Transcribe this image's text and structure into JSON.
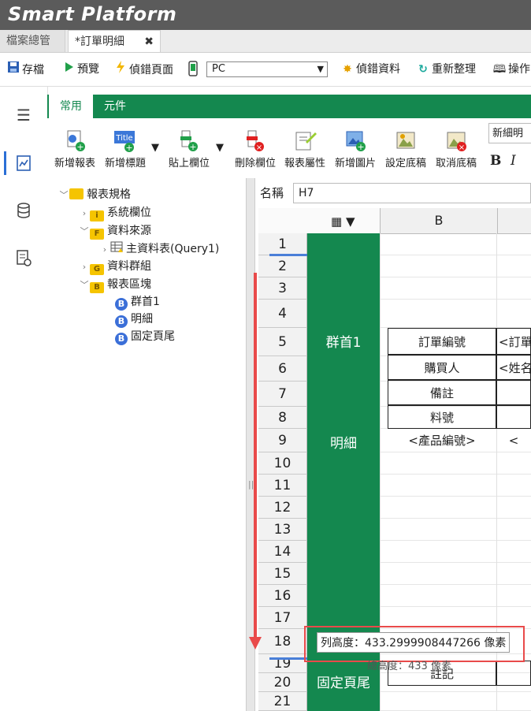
{
  "app": {
    "title": "Smart Platform"
  },
  "doc_tabs": [
    {
      "label": "檔案總管"
    },
    {
      "label": "*訂單明細",
      "close": "✖"
    }
  ],
  "toolbar": {
    "save": "存檔",
    "preview": "預覽",
    "debug_page": "偵錯頁面",
    "device_select": "PC",
    "debug_data": "偵錯資料",
    "refresh": "重新整理",
    "ops": "操作"
  },
  "ribbon": {
    "tabs": [
      "常用",
      "元件"
    ],
    "buttons": [
      "新增報表",
      "新增標題",
      "貼上欄位",
      "刪除欄位",
      "報表屬性",
      "新增圖片",
      "設定底稿",
      "取消底稿"
    ],
    "title_icon_text": "Title",
    "style_box": "新細明",
    "bold": "B",
    "italic": "I"
  },
  "tree": {
    "root": "報表規格",
    "items": [
      {
        "label": "系統欄位",
        "badge": "i"
      },
      {
        "label": "資料來源",
        "badge": "F"
      },
      {
        "label": "主資料表(Query1)"
      },
      {
        "label": "資料群組",
        "badge": "G"
      },
      {
        "label": "報表區塊",
        "badge": "B"
      },
      {
        "label": "群首1",
        "badge": "B"
      },
      {
        "label": "明細",
        "badge": "B"
      },
      {
        "label": "固定頁尾",
        "badge": "B"
      }
    ]
  },
  "namebar": {
    "label": "名稱",
    "value": "H7"
  },
  "grid": {
    "column_header": "B",
    "rows": [
      "1",
      "2",
      "3",
      "4",
      "5",
      "6",
      "7",
      "8",
      "9",
      "10",
      "11",
      "12",
      "13",
      "14",
      "15",
      "16",
      "17",
      "18",
      "19",
      "20",
      "21"
    ],
    "bands": [
      "群首1",
      "明細",
      "固定頁尾"
    ],
    "cells": {
      "r5_b": "訂單編號",
      "r5_c": "<訂單",
      "r6_b": "購買人",
      "r6_c": "<姓名",
      "r7_b": "備註",
      "r8_b": "料號",
      "r9_b": "<產品編號>",
      "r9_c": "<",
      "r19_b": "註記"
    }
  },
  "tooltip": {
    "text": "列高度：433.2999908447266 像素",
    "below": "總高度：433 像素"
  },
  "colors": {
    "green": "#14884f",
    "red": "#e94a4a",
    "titlebar": "#5b5b5b"
  }
}
